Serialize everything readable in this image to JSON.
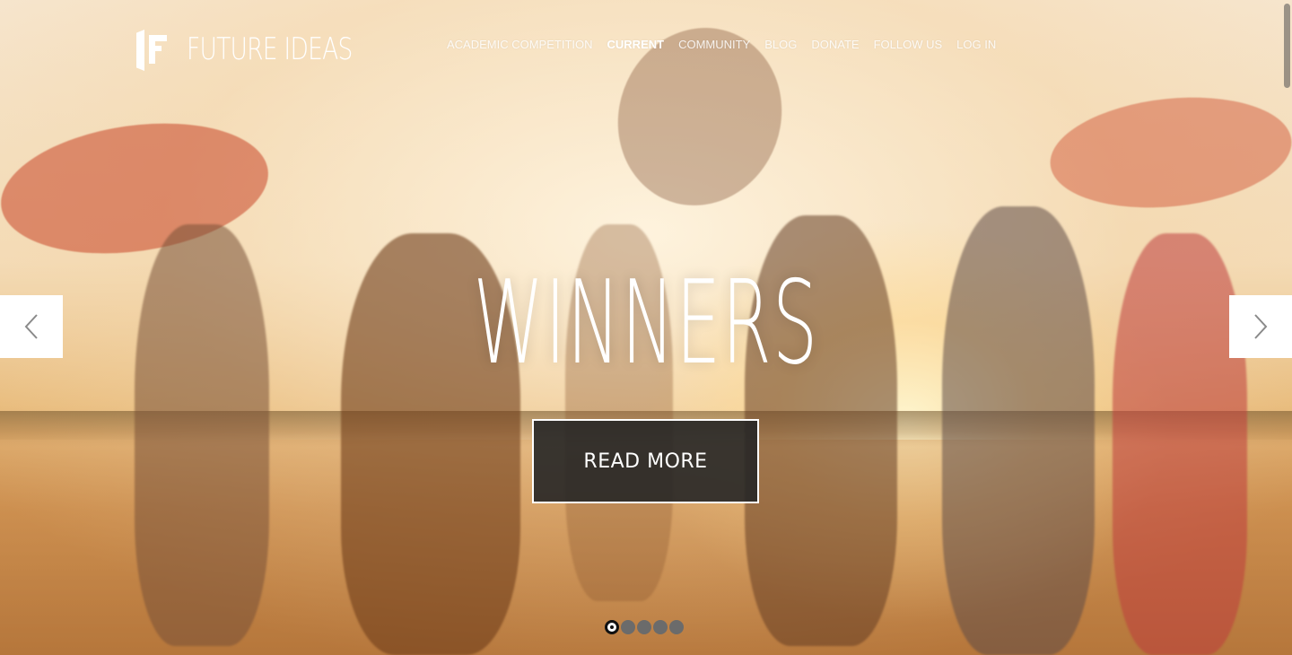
{
  "brand": {
    "name": "FUTURE IDEAS",
    "logo_icon": "future-ideas-logo"
  },
  "nav": {
    "items": [
      {
        "label": "ACADEMIC COMPETITION",
        "active": false
      },
      {
        "label": "CURRENT",
        "active": true
      },
      {
        "label": "COMMUNITY",
        "active": false
      },
      {
        "label": "BLOG",
        "active": false
      },
      {
        "label": "DONATE",
        "active": false
      },
      {
        "label": "FOLLOW US",
        "active": false
      },
      {
        "label": "LOG IN",
        "active": false
      }
    ]
  },
  "hero": {
    "headline": "WINNERS",
    "cta_label": "READ MORE",
    "prev_icon": "chevron-left-icon",
    "next_icon": "chevron-right-icon",
    "slides_count": 5,
    "active_slide": 1
  },
  "colors": {
    "cta_bg": "#262626",
    "arrow_bg": "#ffffff",
    "dot_inactive": "#6b6b6b",
    "dot_active": "#ffffff"
  }
}
